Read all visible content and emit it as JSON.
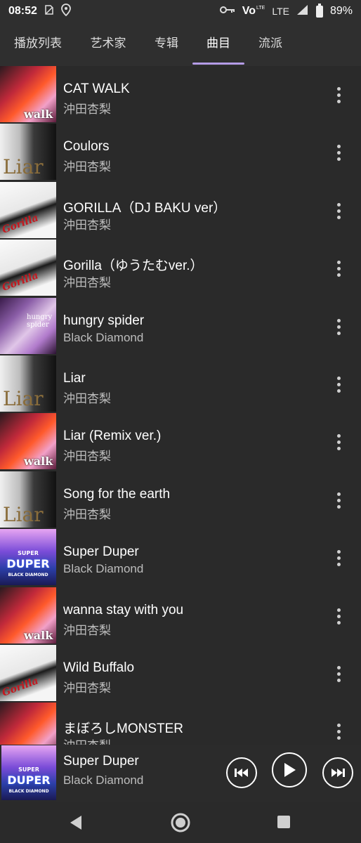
{
  "status": {
    "time": "08:52",
    "network": "LTE",
    "battery": "89%",
    "volte": "Vo",
    "volte_sub": "LTE"
  },
  "tabs": [
    {
      "label": "播放列表",
      "active": false
    },
    {
      "label": "艺术家",
      "active": false
    },
    {
      "label": "专辑",
      "active": false
    },
    {
      "label": "曲目",
      "active": true
    },
    {
      "label": "流派",
      "active": false
    }
  ],
  "songs": [
    {
      "title": "CAT WALK",
      "artist": "沖田杏梨",
      "art": "catwalk"
    },
    {
      "title": "Coulors",
      "artist": "沖田杏梨",
      "art": "liar"
    },
    {
      "title": "GORILLA（DJ BAKU ver）",
      "artist": "沖田杏梨",
      "art": "gorilla"
    },
    {
      "title": "Gorilla（ゆうたむver.）",
      "artist": "沖田杏梨",
      "art": "gorilla"
    },
    {
      "title": "hungry spider",
      "artist": "Black Diamond",
      "art": "spider"
    },
    {
      "title": "Liar",
      "artist": "沖田杏梨",
      "art": "liar"
    },
    {
      "title": "Liar (Remix ver.)",
      "artist": "沖田杏梨",
      "art": "catwalk"
    },
    {
      "title": "Song for the earth",
      "artist": "沖田杏梨",
      "art": "liar"
    },
    {
      "title": "Super Duper",
      "artist": "Black Diamond",
      "art": "duper"
    },
    {
      "title": "wanna stay with you",
      "artist": "沖田杏梨",
      "art": "catwalk"
    },
    {
      "title": "Wild Buffalo",
      "artist": "沖田杏梨",
      "art": "gorilla"
    },
    {
      "title": "まぼろしMONSTER",
      "artist": "沖田杏梨",
      "art": "catwalk"
    }
  ],
  "art_labels": {
    "catwalk": "walk",
    "liar": "Liar",
    "gorilla": "Gorilla",
    "spider": "hungry spider",
    "duper_top": "SUPER",
    "duper_main": "DUPER",
    "duper_sub": "BLACK DIAMOND"
  },
  "now_playing": {
    "title": "Super Duper",
    "artist": "Black Diamond",
    "art": "duper"
  },
  "icons": {
    "more": "more-vert-icon",
    "prev": "skip-previous-icon",
    "play": "play-icon",
    "next": "skip-next-icon",
    "back": "back-icon",
    "home": "home-icon",
    "recents": "recents-icon"
  },
  "colors": {
    "accent": "#b49be6",
    "background": "#2a2a2a",
    "bar": "#2f2f2f"
  }
}
